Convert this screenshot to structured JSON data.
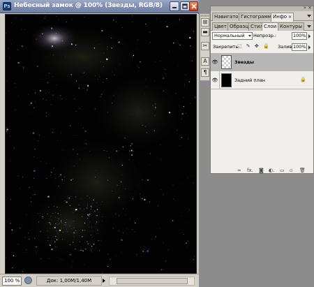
{
  "document": {
    "title": "Небесный замок @ 100% (Звезды, RGB/8)",
    "app_icon": "Ps",
    "zoom": "100 %",
    "doc_info": "Док: 1,00М/1,40М"
  },
  "tool_strip": {
    "icons": [
      "history-brush-icon",
      "layer-comps-icon",
      "tool-presets-icon",
      "character-icon",
      "paragraph-icon"
    ],
    "glyphs": [
      "⊞",
      "▬",
      "✂",
      "A",
      "¶"
    ]
  },
  "palette": {
    "top_tabs": [
      {
        "label": "Навигатор",
        "active": false
      },
      {
        "label": "Гистограмма",
        "active": false
      },
      {
        "label": "Инфо",
        "active": true,
        "close": "×"
      }
    ],
    "bottom_tabs": [
      {
        "label": "Цвет",
        "active": false
      },
      {
        "label": "Образцы",
        "active": false
      },
      {
        "label": "Стили",
        "active": false
      },
      {
        "label": "Слои",
        "active": true,
        "close": "×"
      },
      {
        "label": "Контуры",
        "active": false
      }
    ],
    "head_close": "×",
    "head_collapse": "»",
    "blend_mode": "Нормальный",
    "opacity_label": "Непрозр.:",
    "opacity_value": "100%",
    "lock_label": "Закрепить:",
    "lock_icons": "⬚ ✎ ✥ 🔒",
    "fill_label": "Заливка:",
    "fill_value": "100%",
    "layers": [
      {
        "name": "Звезды",
        "visible": true,
        "selected": true,
        "thumb": "transparent",
        "locked": false
      },
      {
        "name": "Задний план",
        "visible": true,
        "selected": false,
        "thumb": "black",
        "locked": true
      }
    ],
    "eye_glyph": "👁",
    "lock_glyph": "🔒",
    "footer_icons": [
      {
        "name": "link-layers-icon",
        "glyph": "∞"
      },
      {
        "name": "layer-style-icon",
        "glyph": "fx."
      },
      {
        "name": "layer-mask-icon",
        "glyph": "◙"
      },
      {
        "name": "adjustment-layer-icon",
        "glyph": "◐."
      },
      {
        "name": "new-group-icon",
        "glyph": "▭"
      },
      {
        "name": "new-layer-icon",
        "glyph": "▫"
      },
      {
        "name": "delete-layer-icon",
        "glyph": "🗑"
      }
    ]
  }
}
